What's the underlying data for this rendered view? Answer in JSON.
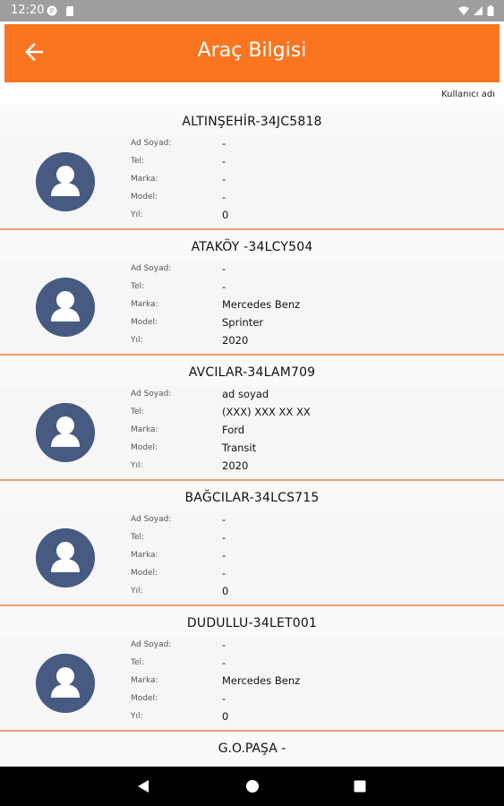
{
  "status_bar": {
    "time": "12:20"
  },
  "app_bar": {
    "title": "Araç Bilgisi"
  },
  "username_label": "Kullanıcı adı",
  "labels": {
    "name": "Ad Soyad:",
    "phone": "Tel:",
    "brand": "Marka:",
    "model": "Model:",
    "year": "Yıl:"
  },
  "vehicles": [
    {
      "header": "ALTINŞEHİR-34JC5818",
      "name": "-",
      "phone": "-",
      "brand": "-",
      "model": "-",
      "year": "0"
    },
    {
      "header": "ATAKÖY -34LCY504",
      "name": "-",
      "phone": "-",
      "brand": "Mercedes Benz",
      "model": "Sprinter",
      "year": "2020"
    },
    {
      "header": "AVCILAR-34LAM709",
      "name": "ad soyad",
      "phone": "(XXX) XXX XX XX",
      "brand": "Ford",
      "model": "Transit",
      "year": "2020"
    },
    {
      "header": "BAĞCILAR-34LCS715",
      "name": "-",
      "phone": "-",
      "brand": "-",
      "model": "-",
      "year": "0"
    },
    {
      "header": "DUDULLU-34LET001",
      "name": "-",
      "phone": "-",
      "brand": "Mercedes Benz",
      "model": "-",
      "year": "0"
    }
  ],
  "partial_vehicle": {
    "header": "G.O.PAŞA -"
  },
  "colors": {
    "accent": "#fb7520",
    "avatar": "#465a82",
    "divider": "#f59a73"
  },
  "icons": {
    "back": "arrow-left-icon",
    "avatar": "user-avatar-icon",
    "nav_back": "triangle-back-icon",
    "nav_home": "circle-home-icon",
    "nav_recents": "square-recents-icon"
  }
}
